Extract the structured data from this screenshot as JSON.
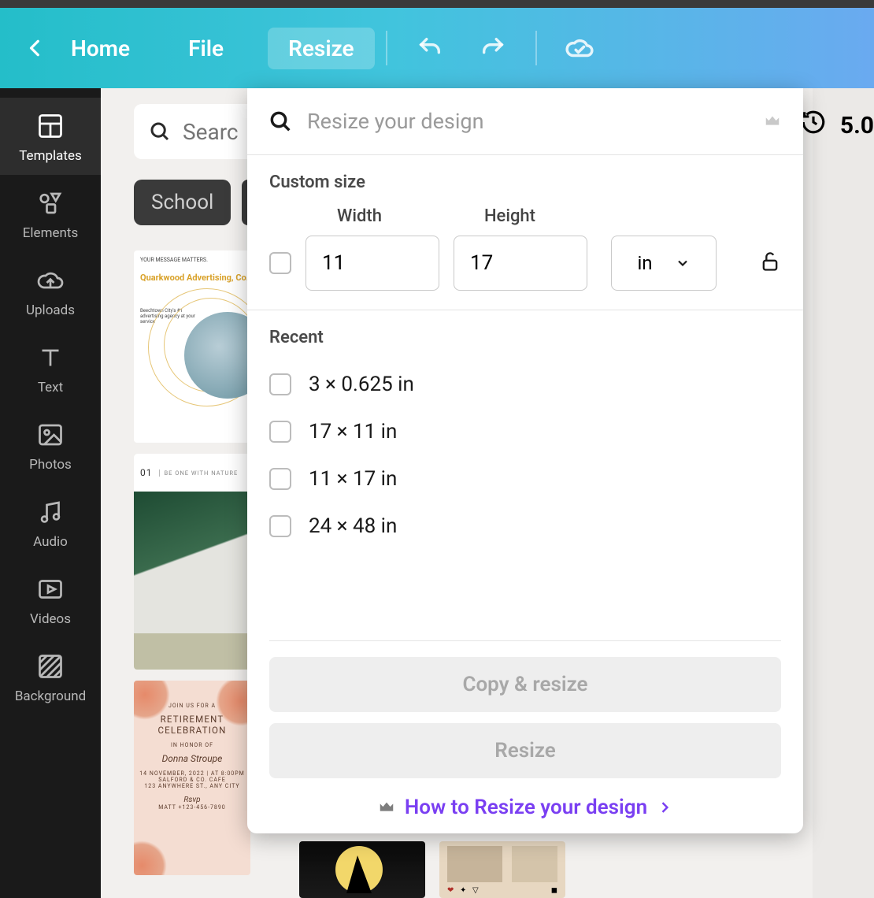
{
  "topbar": {
    "home_label": "Home",
    "file_label": "File",
    "resize_label": "Resize"
  },
  "sidebar": {
    "items": [
      {
        "label": "Templates"
      },
      {
        "label": "Elements"
      },
      {
        "label": "Uploads"
      },
      {
        "label": "Text"
      },
      {
        "label": "Photos"
      },
      {
        "label": "Audio"
      },
      {
        "label": "Videos"
      },
      {
        "label": "Background"
      }
    ]
  },
  "search": {
    "placeholder": "Search templates"
  },
  "chips": [
    "School"
  ],
  "zoom_value": "5.0",
  "panel": {
    "search_placeholder": "Resize your design",
    "custom_heading": "Custom size",
    "width_label": "Width",
    "height_label": "Height",
    "width_value": "11",
    "height_value": "17",
    "unit": "in",
    "recent_heading": "Recent",
    "recent_items": [
      "3 × 0.625 in",
      "17 × 11 in",
      "11 × 17 in",
      "24 × 48 in"
    ],
    "copy_resize_label": "Copy & resize",
    "resize_label": "Resize",
    "howto_label": "How to Resize your design"
  },
  "template_thumbs": {
    "t1_tag": "YOUR MESSAGE MATTERS.",
    "t1_title": "Quarkwood Advertising, Co.",
    "t1_sub": "Beechtown City's #1 advertising agency at your service",
    "t2_num": "01",
    "t2_cap": "BE ONE WITH NATURE",
    "t3_join": "JOIN US FOR A",
    "t3_l1": "RETIREMENT",
    "t3_l2": "CELEBRATION",
    "t3_honor": "IN HONOR OF",
    "t3_name": "Donna Stroupe",
    "t3_when": "14 NOVEMBER, 2022 | AT 8:00PM",
    "t3_where1": "SALFORD & CO. CAFE",
    "t3_where2": "123 ANYWHERE ST., ANY CITY",
    "t3_rsvp": "Rsvp",
    "t3_phone": "MATT +123-456-7890"
  }
}
